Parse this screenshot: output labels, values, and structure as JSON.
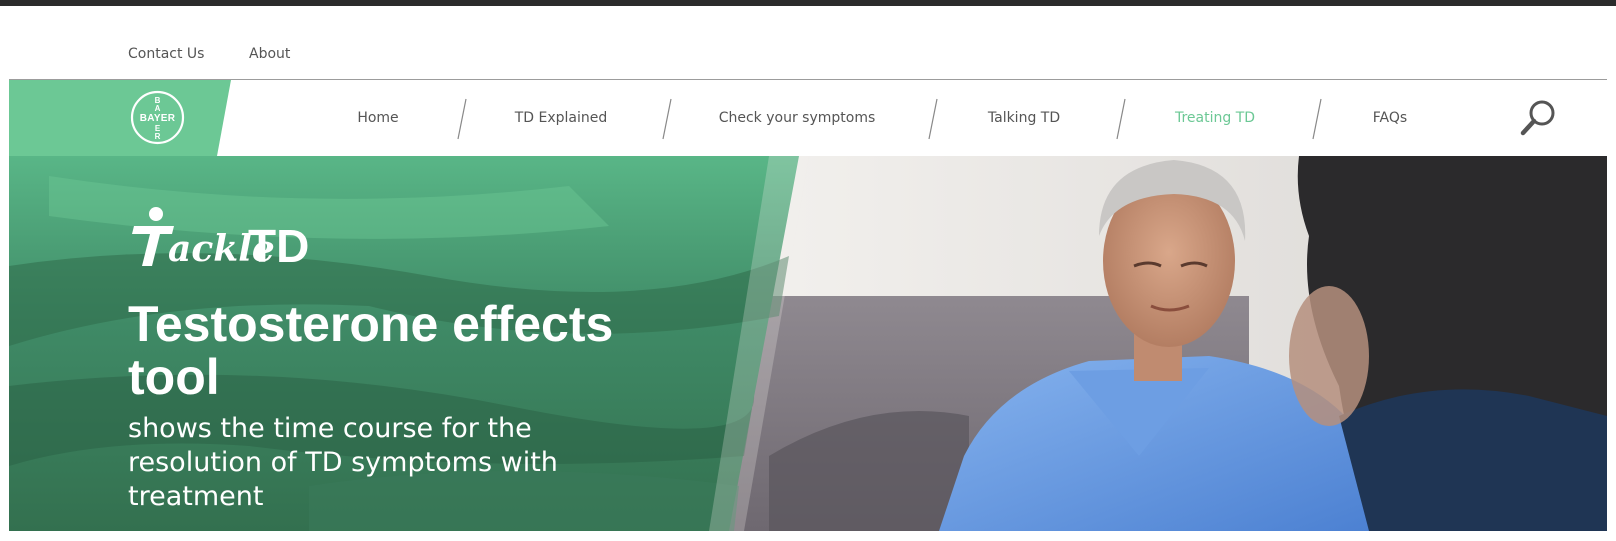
{
  "utility_nav": {
    "contact_label": "Contact Us",
    "about_label": "About"
  },
  "brand": {
    "logo_text": "BAYER",
    "accent_color": "#6cc895"
  },
  "main_nav": {
    "items": [
      {
        "label": "Home",
        "active": false
      },
      {
        "label": "TD Explained",
        "active": false
      },
      {
        "label": "Check your symptoms",
        "active": false
      },
      {
        "label": "Talking TD",
        "active": false
      },
      {
        "label": "Treating TD",
        "active": true
      },
      {
        "label": "FAQs",
        "active": false
      }
    ],
    "search_icon": "search-icon"
  },
  "hero": {
    "logo_text": "TackleTD",
    "title": "Testosterone effects tool",
    "subtitle": "shows the time course for the resolution of TD symptoms with treatment"
  }
}
